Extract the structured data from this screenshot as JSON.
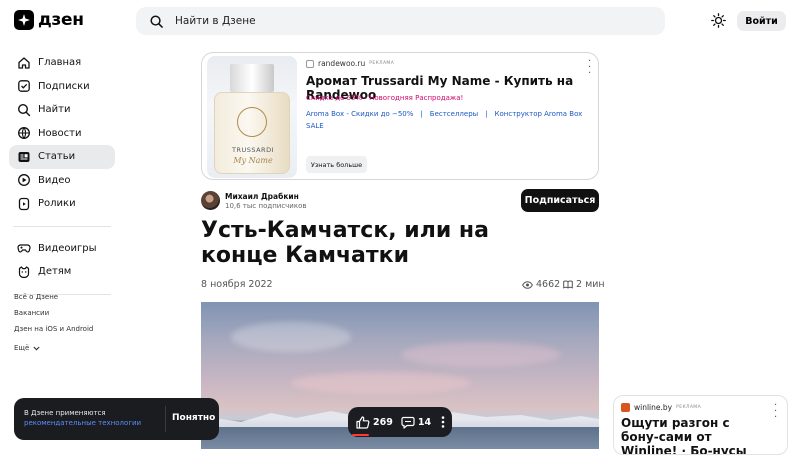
{
  "header": {
    "logo_text": "дзен",
    "search_placeholder": "Найти в Дзене",
    "login_label": "Войти"
  },
  "sidebar": {
    "items": [
      {
        "label": "Главная",
        "icon": "home-icon",
        "active": false
      },
      {
        "label": "Подписки",
        "icon": "subscriptions-icon",
        "active": false
      },
      {
        "label": "Найти",
        "icon": "search-icon",
        "active": false
      },
      {
        "label": "Новости",
        "icon": "news-icon",
        "active": false
      },
      {
        "label": "Статьи",
        "icon": "articles-icon",
        "active": true
      },
      {
        "label": "Видео",
        "icon": "video-icon",
        "active": false
      },
      {
        "label": "Ролики",
        "icon": "shorts-icon",
        "active": false
      }
    ],
    "secondary": [
      {
        "label": "Видеоигры",
        "icon": "gamepad-icon"
      },
      {
        "label": "Детям",
        "icon": "kids-icon"
      }
    ],
    "footer_links": [
      "Всё о Дзене",
      "Вакансии",
      "Дзен на iOS и Android",
      "Ещё"
    ]
  },
  "ad": {
    "domain": "randewoo.ru",
    "tag": "реклама",
    "title": "Аромат Trussardi My Name - Купить на Randewoo",
    "subtitle": "Скидка до 55% - Новогодняя Распродажа!",
    "links": [
      "Aroma Box - Скидки до −50%",
      "Бестселлеры",
      "Конструктор Aroma Box",
      "SALE"
    ],
    "button": "Узнать больше",
    "image_brand": "TRUSSARDI",
    "image_script": "My Name"
  },
  "article": {
    "author_name": "Михаил Драбкин",
    "author_subs": "10,6 тыс подписчиков",
    "subscribe_label": "Подписаться",
    "title": "Усть-Камчатск, или на конце Камчатки",
    "date": "8 ноября 2022",
    "views": "4662",
    "read_time": "2 мин"
  },
  "cookie": {
    "text": "В Дзене применяются",
    "link": "рекомендательные технологии",
    "button": "Понятно"
  },
  "actions": {
    "likes": "269",
    "comments": "14"
  },
  "right_ad": {
    "domain": "winline.by",
    "tag": "реклама",
    "title": "Ощути разгон с бону-сами от Winline! · Бо-нусы ждут каждого"
  }
}
